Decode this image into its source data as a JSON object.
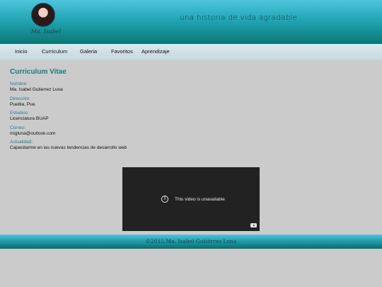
{
  "header": {
    "logo_text": "Ma. Isabel",
    "tagline": "una historia de vida agradable"
  },
  "nav": {
    "items": [
      "Inicio",
      "Curriculum",
      "Galeria",
      "Favoritos",
      "Aprendizaje"
    ]
  },
  "main": {
    "title": "Curriculum Vitae",
    "fields": [
      {
        "label": "Nombre:",
        "value": "Ma. Isabel Gutierrez Luna"
      },
      {
        "label": "Dirección:",
        "value": "Puebla, Pue."
      },
      {
        "label": "Estudios:",
        "value": "Licenciatura BUAP"
      },
      {
        "label": "Correo:",
        "value": "migluna@outlook.com"
      },
      {
        "label": "Actualidad:",
        "value": "Capacitarme en las nuevas tendencias de desarrollo web"
      }
    ]
  },
  "video": {
    "message": "This video is unavailable",
    "icon": "exclamation-circle-icon"
  },
  "footer": {
    "copyright": "©2015 Ma. Isabel Gutiérrez Luna"
  },
  "colors": {
    "header_teal": "#22a6b6",
    "accent_text": "#157c83",
    "page_bg": "#cbcbcb"
  }
}
